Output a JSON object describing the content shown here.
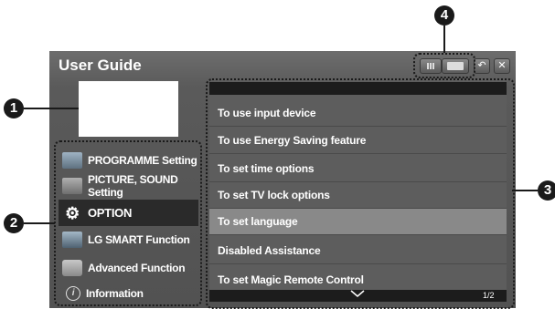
{
  "window": {
    "title": "User Guide",
    "controls": {
      "back_label": "⮌",
      "close_label": "✕",
      "grid_icon": "grid-icon",
      "folder_icon": "folder-icon"
    }
  },
  "menu": {
    "items": [
      {
        "label": "PROGRAMME Setting",
        "icon": "programme-icon",
        "selected": false
      },
      {
        "label": "PICTURE, SOUND Setting",
        "icon": "picture-sound-icon",
        "selected": false
      },
      {
        "label": "OPTION",
        "icon": "gear-icon",
        "selected": true
      },
      {
        "label": "LG SMART Function",
        "icon": "smart-icon",
        "selected": false
      },
      {
        "label": "Advanced Function",
        "icon": "advanced-icon",
        "selected": false
      },
      {
        "label": "Information",
        "icon": "info-icon",
        "selected": false
      }
    ]
  },
  "list": {
    "items": [
      {
        "label": "To use input device",
        "selected": false
      },
      {
        "label": "To use Energy Saving feature",
        "selected": false
      },
      {
        "label": "To set time options",
        "selected": false
      },
      {
        "label": "To set TV lock options",
        "selected": false
      },
      {
        "label": "To set language",
        "selected": true
      },
      {
        "label": "Disabled Assistance",
        "selected": false
      },
      {
        "label": "To set Magic Remote Control",
        "selected": false
      }
    ],
    "page_indicator": "1/2"
  },
  "callouts": {
    "one": "1",
    "two": "2",
    "three": "3",
    "four": "4"
  },
  "colors": {
    "window_bg": "#5a5a5a",
    "selected_menu": "#2a2a2a",
    "selected_list": "#898989",
    "callout": "#1a1a1a"
  }
}
